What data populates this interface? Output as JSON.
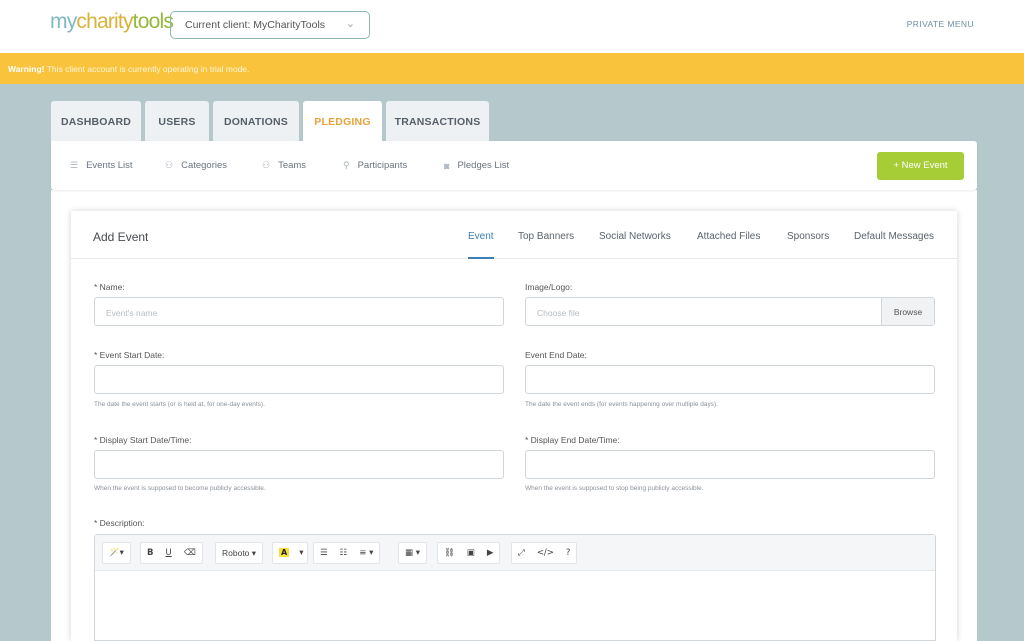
{
  "header": {
    "logo": [
      "my",
      "charity",
      "tools"
    ],
    "client_select": "Current client: MyCharityTools",
    "private_menu": "PRIVATE MENU"
  },
  "warning": {
    "label": "Warning!",
    "text": " This client account is currently operating in trial mode."
  },
  "main_tabs": [
    "DASHBOARD",
    "USERS",
    "DONATIONS",
    "PLEDGING",
    "TRANSACTIONS"
  ],
  "active_main_tab": "PLEDGING",
  "subnav": [
    {
      "label": "Events List",
      "icon": "list-icon"
    },
    {
      "label": "Categories",
      "icon": "users-icon"
    },
    {
      "label": "Teams",
      "icon": "users-icon"
    },
    {
      "label": "Participants",
      "icon": "user-icon"
    },
    {
      "label": "Pledges List",
      "icon": "camera-icon"
    }
  ],
  "new_event_label": "+ New Event",
  "panel": {
    "title": "Add Event",
    "tabs": [
      "Event",
      "Top Banners",
      "Social Networks",
      "Attached Files",
      "Sponsors",
      "Default Messages"
    ],
    "active_tab": "Event"
  },
  "form": {
    "name_label": "* Name:",
    "name_placeholder": "Event's name",
    "image_label": "Image/Logo:",
    "image_placeholder": "Choose file",
    "browse_label": "Browse",
    "start_label": "* Event Start Date:",
    "start_help": "The date the event starts (or is held at, for one-day events).",
    "end_label": "Event End Date:",
    "end_help": "The date the event ends (for events happening over multiple days).",
    "disp_start_label": "* Display Start Date/Time:",
    "disp_start_help": "When the event is supposed to become publicly accessible.",
    "disp_end_label": "* Display End Date/Time:",
    "disp_end_help": "When the event is supposed to stop being publicly accessible.",
    "desc_label": "* Description:"
  },
  "toolbar": {
    "magic": "🪄▾",
    "bold": "B",
    "underline": "U",
    "eraser": "⌫",
    "font": "Roboto ▾",
    "color": "A",
    "color_caret": "▾",
    "ul": "☰",
    "ol": "☷",
    "align": "≡ ▾",
    "table": "▦ ▾",
    "link": "⛓",
    "image": "▣",
    "video": "▶",
    "fullscreen": "⤢",
    "code": "</>",
    "help": "?"
  },
  "colors": {
    "warning": "#f9c33c",
    "accent_orange": "#e8a33a",
    "new_event_green": "#a6cd36",
    "active_tab_blue": "#3a7fb5"
  }
}
